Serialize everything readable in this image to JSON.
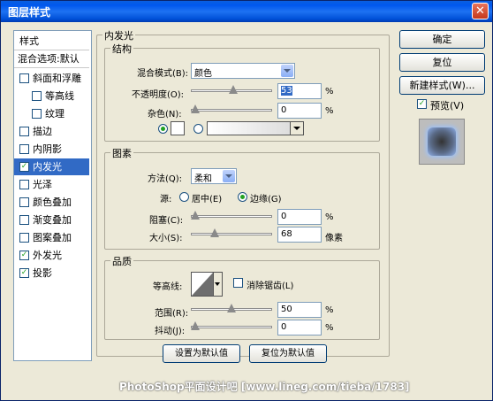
{
  "window": {
    "title": "图层样式",
    "close_glyph": "✕"
  },
  "sidebar": {
    "header": "样式",
    "blend_default": "混合选项:默认",
    "items": [
      {
        "label": "斜面和浮雕",
        "checked": false,
        "indent": false
      },
      {
        "label": "等高线",
        "checked": false,
        "indent": true
      },
      {
        "label": "纹理",
        "checked": false,
        "indent": true
      },
      {
        "label": "描边",
        "checked": false,
        "indent": false
      },
      {
        "label": "内阴影",
        "checked": false,
        "indent": false
      },
      {
        "label": "内发光",
        "checked": true,
        "indent": false,
        "selected": true
      },
      {
        "label": "光泽",
        "checked": false,
        "indent": false
      },
      {
        "label": "颜色叠加",
        "checked": false,
        "indent": false
      },
      {
        "label": "渐变叠加",
        "checked": false,
        "indent": false
      },
      {
        "label": "图案叠加",
        "checked": false,
        "indent": false
      },
      {
        "label": "外发光",
        "checked": true,
        "indent": false
      },
      {
        "label": "投影",
        "checked": true,
        "indent": false
      }
    ]
  },
  "panel": {
    "title": "内发光"
  },
  "structure": {
    "title": "结构",
    "blend_mode_label": "混合模式(B):",
    "blend_mode_value": "颜色",
    "opacity_label": "不透明度(O):",
    "opacity_value": "53",
    "opacity_unit": "%",
    "opacity_level": 0.53,
    "noise_label": "杂色(N):",
    "noise_value": "0",
    "noise_unit": "%",
    "noise_level": 0
  },
  "elements": {
    "title": "图素",
    "method_label": "方法(Q):",
    "method_value": "柔和",
    "source_label": "源:",
    "source_center": "居中(E)",
    "source_edge": "边缘(G)",
    "choke_label": "阻塞(C):",
    "choke_value": "0",
    "choke_unit": "%",
    "choke_level": 0,
    "size_label": "大小(S):",
    "size_value": "68",
    "size_unit": "像素",
    "size_level": 0.27
  },
  "quality": {
    "title": "品质",
    "contour_label": "等高线:",
    "antialias_label": "消除锯齿(L)",
    "range_label": "范围(R):",
    "range_value": "50",
    "range_unit": "%",
    "range_level": 0.5,
    "jitter_label": "抖动(J):",
    "jitter_value": "0",
    "jitter_unit": "%",
    "jitter_level": 0
  },
  "footer": {
    "set_default": "设置为默认值",
    "reset_default": "复位为默认值"
  },
  "buttons": {
    "ok": "确定",
    "reset": "复位",
    "new_style": "新建样式(W)...",
    "preview": "预览(V)"
  },
  "watermark": "PhotoShop平面设计吧  [www.lineg.com/tieba/1783]"
}
